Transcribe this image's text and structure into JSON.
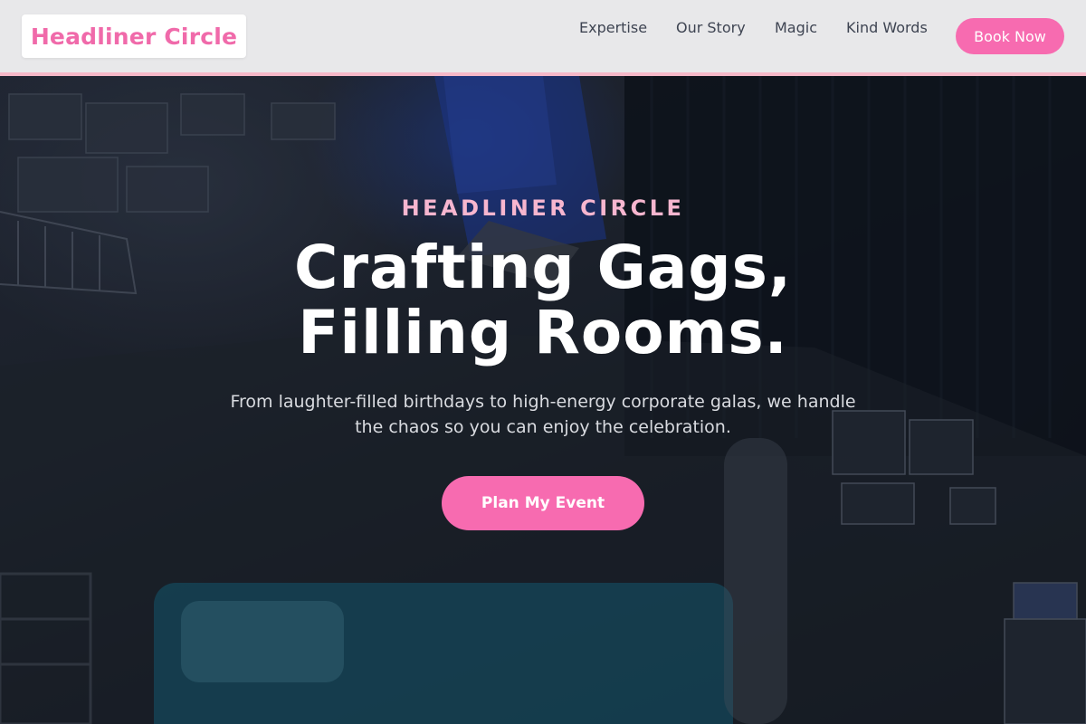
{
  "header": {
    "logo": "Headliner Circle",
    "nav": [
      {
        "label": "Expertise"
      },
      {
        "label": "Our Story"
      },
      {
        "label": "Magic"
      },
      {
        "label": "Kind Words"
      }
    ],
    "cta_label": "Book Now"
  },
  "hero": {
    "eyebrow": "HEADLINER CIRCLE",
    "headline": "Crafting Gags, Filling Rooms.",
    "subheadline": "From laughter-filled birthdays to high-energy corporate galas, we handle the chaos so you can enjoy the celebration.",
    "cta_label": "Plan My Event"
  },
  "colors": {
    "brand_pink": "#f76bb0",
    "logo_pink": "#f06aaa",
    "eyebrow_pink": "#f7b6cf",
    "header_bg": "#e8e8ea",
    "header_border": "#f6b8c8",
    "nav_text": "#3e4452"
  }
}
